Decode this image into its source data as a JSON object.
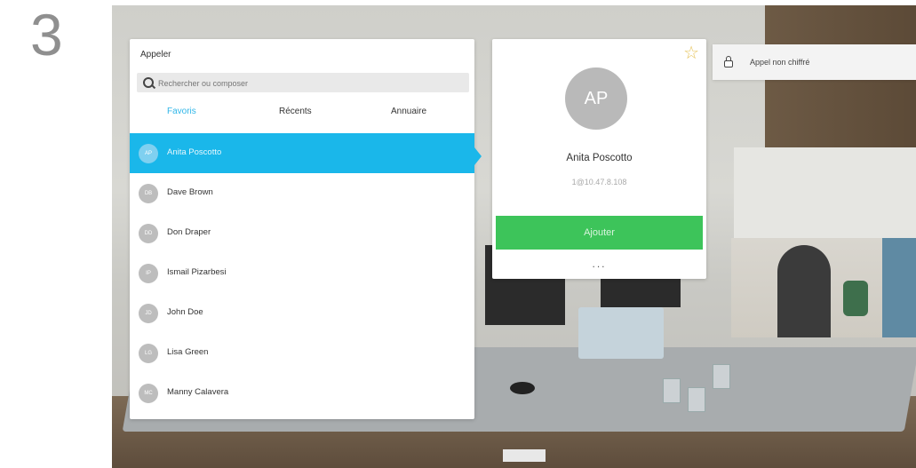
{
  "step_number": "3",
  "call_panel": {
    "title": "Appeler",
    "search_placeholder": "Rechercher ou composer",
    "tabs": [
      {
        "label": "Favoris",
        "active": true
      },
      {
        "label": "Récents",
        "active": false
      },
      {
        "label": "Annuaire",
        "active": false
      }
    ],
    "contacts": [
      {
        "initials": "AP",
        "name": "Anita Poscotto",
        "selected": true
      },
      {
        "initials": "DB",
        "name": "Dave Brown",
        "selected": false
      },
      {
        "initials": "DD",
        "name": "Don Draper",
        "selected": false
      },
      {
        "initials": "IP",
        "name": "Ismail Pizarbesi",
        "selected": false
      },
      {
        "initials": "JD",
        "name": "John Doe",
        "selected": false
      },
      {
        "initials": "LG",
        "name": "Lisa Green",
        "selected": false
      },
      {
        "initials": "MC",
        "name": "Manny Calavera",
        "selected": false
      }
    ]
  },
  "contact_card": {
    "initials": "AP",
    "name": "Anita Poscotto",
    "address": "1@10.47.8.108",
    "add_label": "Ajouter",
    "more_label": "...",
    "favorite_icon": "star-icon"
  },
  "status": {
    "text": "Appel non chiffré",
    "icon": "lock-icon"
  },
  "colors": {
    "accent_blue": "#1ab7ea",
    "add_green": "#3dc45a",
    "favorite_star": "#e6c35a"
  }
}
